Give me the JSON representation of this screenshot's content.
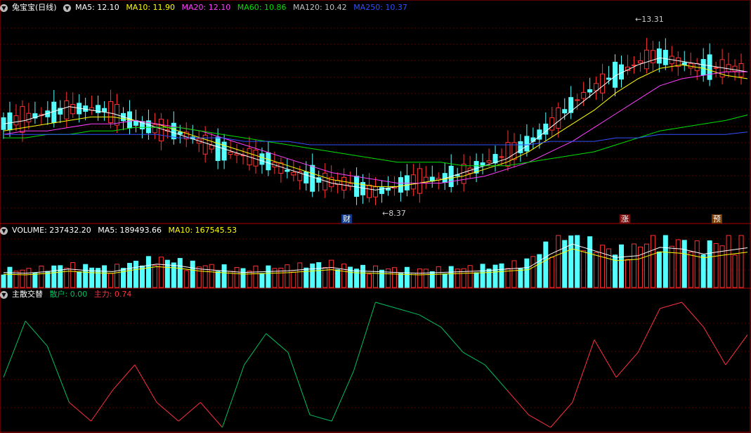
{
  "main_legend": {
    "title": "兔宝宝(日线)",
    "ma5": "MA5: 12.10",
    "ma10": "MA10: 11.90",
    "ma20": "MA20: 12.10",
    "ma60": "MA60: 10.86",
    "ma120": "MA120: 10.42",
    "ma250": "MA250: 10.37"
  },
  "volume_legend": {
    "volume": "VOLUME: 237432.20",
    "ma5": "MA5: 189493.66",
    "ma10": "MA10: 167545.53"
  },
  "indicator_legend": {
    "title": "主散交替",
    "retail": "散户: 0.00",
    "main": "主力: 0.74"
  },
  "annotations": {
    "high": "13.31",
    "low": "8.37"
  },
  "event_tags": {
    "cai": "财",
    "zhang": "涨",
    "yu": "预"
  },
  "colors": {
    "up": "#ff3232",
    "down": "#54ffff",
    "ma5": "#ffffff",
    "ma10": "#ffff00",
    "ma20": "#ff40ff",
    "ma60": "#00e000",
    "ma120": "#c0c0c0",
    "ma250": "#3050ff",
    "retail": "#00c060",
    "main": "#ff3040"
  },
  "chart_data": [
    {
      "type": "line",
      "series": [
        {
          "name": "MA5",
          "values": [
            10.6,
            10.7,
            10.9,
            11.1,
            11.0,
            10.9,
            10.7,
            10.5,
            10.3,
            10.1,
            9.9,
            9.7,
            9.5,
            9.3,
            9.1,
            8.9,
            8.8,
            8.7,
            8.8,
            8.9,
            9.0,
            9.2,
            9.4,
            9.6,
            10.0,
            10.5,
            11.0,
            11.5,
            12.0,
            12.3,
            12.5,
            12.4,
            12.3,
            12.2,
            12.1
          ]
        },
        {
          "name": "MA10",
          "values": [
            10.4,
            10.5,
            10.6,
            10.7,
            10.8,
            10.8,
            10.7,
            10.6,
            10.4,
            10.2,
            10.0,
            9.8,
            9.6,
            9.4,
            9.2,
            9.0,
            8.9,
            8.8,
            8.8,
            8.9,
            9.0,
            9.1,
            9.3,
            9.5,
            9.8,
            10.2,
            10.6,
            11.0,
            11.5,
            11.9,
            12.2,
            12.3,
            12.2,
            12.0,
            11.9
          ]
        },
        {
          "name": "MA20",
          "values": [
            10.3,
            10.4,
            10.4,
            10.5,
            10.6,
            10.6,
            10.7,
            10.6,
            10.5,
            10.4,
            10.2,
            10.0,
            9.8,
            9.6,
            9.4,
            9.2,
            9.1,
            9.0,
            8.9,
            8.9,
            8.9,
            9.0,
            9.1,
            9.3,
            9.5,
            9.8,
            10.1,
            10.5,
            10.9,
            11.3,
            11.7,
            11.9,
            12.0,
            12.1,
            12.1
          ]
        },
        {
          "name": "MA60",
          "values": [
            10.2,
            10.2,
            10.3,
            10.3,
            10.4,
            10.4,
            10.5,
            10.5,
            10.5,
            10.4,
            10.3,
            10.2,
            10.1,
            10.0,
            9.9,
            9.8,
            9.7,
            9.6,
            9.5,
            9.5,
            9.5,
            9.4,
            9.4,
            9.4,
            9.5,
            9.6,
            9.7,
            9.8,
            10.0,
            10.2,
            10.4,
            10.5,
            10.6,
            10.7,
            10.86
          ]
        },
        {
          "name": "MA250",
          "values": [
            10.3,
            10.3,
            10.3,
            10.3,
            10.3,
            10.3,
            10.3,
            10.3,
            10.2,
            10.2,
            10.2,
            10.1,
            10.1,
            10.1,
            10.0,
            10.0,
            10.0,
            10.0,
            10.0,
            10.0,
            10.0,
            10.0,
            10.0,
            10.0,
            10.0,
            10.1,
            10.1,
            10.1,
            10.2,
            10.2,
            10.3,
            10.3,
            10.3,
            10.3,
            10.37
          ]
        }
      ],
      "high_label": 13.31,
      "low_label": 8.37
    },
    {
      "type": "bar",
      "name": "VOLUME",
      "values": [
        90000,
        85000,
        95000,
        110000,
        100000,
        95000,
        120000,
        140000,
        130000,
        110000,
        100000,
        90000,
        95000,
        100000,
        110000,
        120000,
        100000,
        95000,
        90000,
        85000,
        90000,
        95000,
        100000,
        110000,
        120000,
        200000,
        260000,
        220000,
        180000,
        190000,
        240000,
        230000,
        200000,
        220000,
        237432
      ]
    },
    {
      "type": "line",
      "name": "主散交替",
      "values": [
        0.4,
        0.85,
        0.65,
        0.2,
        0.05,
        0.3,
        0.5,
        0.2,
        0.05,
        0.2,
        0.0,
        0.5,
        0.75,
        0.6,
        0.1,
        0.05,
        0.45,
        1.0,
        0.95,
        0.9,
        0.8,
        0.6,
        0.5,
        0.3,
        0.1,
        0.0,
        0.2,
        0.7,
        0.4,
        0.6,
        0.95,
        1.0,
        0.8,
        0.5,
        0.74
      ]
    }
  ]
}
